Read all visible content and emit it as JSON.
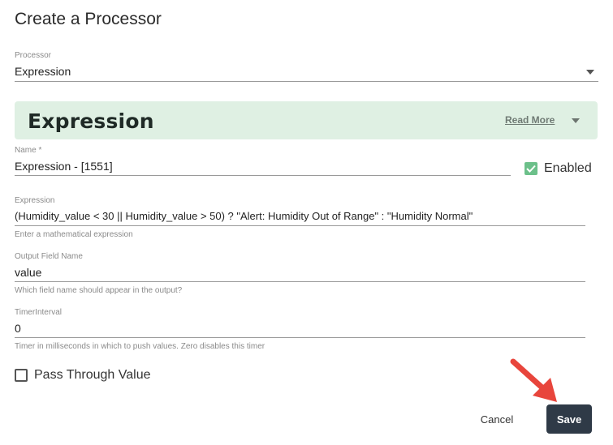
{
  "dialog": {
    "title": "Create a Processor"
  },
  "processor": {
    "label": "Processor",
    "value": "Expression"
  },
  "banner": {
    "title": "Expression",
    "read_more": "Read More"
  },
  "name": {
    "label": "Name *",
    "value": "Expression  - [1551]"
  },
  "enabled": {
    "label": "Enabled",
    "checked": true
  },
  "expression": {
    "label": "Expression",
    "value": "(Humidity_value < 30 || Humidity_value > 50) ? \"Alert: Humidity Out of Range\" : \"Humidity Normal\"",
    "helper": "Enter a mathematical expression"
  },
  "output_field": {
    "label": "Output Field Name",
    "value": "value",
    "helper": "Which field name should appear in the output?"
  },
  "timer": {
    "label": "TimerInterval",
    "value": "0",
    "helper": "Timer in milliseconds in which to push values. Zero disables this timer"
  },
  "pass_through": {
    "label": "Pass Through Value",
    "checked": false
  },
  "actions": {
    "cancel": "Cancel",
    "save": "Save"
  },
  "colors": {
    "banner_bg": "#dff0e3",
    "checkbox_checked": "#6cc08a",
    "save_bg": "#2f3a47",
    "annotation_arrow": "#e8453c"
  },
  "icons": {
    "processor_dropdown": "chevron-down-icon",
    "banner_dropdown": "chevron-down-icon",
    "enabled_check": "checkmark-icon",
    "annotation": "red-arrow-icon"
  }
}
